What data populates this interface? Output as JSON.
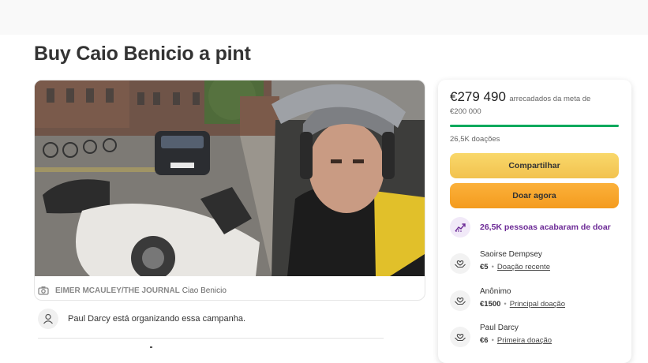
{
  "page": {
    "title": "Buy Caio Benicio a pint"
  },
  "photo": {
    "credit": "EIMER MCAULEY/THE JOURNAL",
    "caption": "Ciao Benicio"
  },
  "organizer": {
    "text": "Paul Darcy está organizando essa campanha."
  },
  "sidebar": {
    "raised_amount": "€279 490",
    "raised_label": "arrecadados da meta de",
    "goal": "€200 000",
    "progress_fraction": 1.0,
    "donations_count": "26,5K doações",
    "share_label": "Compartilhar",
    "donate_label": "Doar agora",
    "recent_banner": "26,5K pessoas acabaram de doar",
    "donors": [
      {
        "name": "Saoirse Dempsey",
        "amount": "€5",
        "tag": "Doação recente"
      },
      {
        "name": "Anônimo",
        "amount": "€1500",
        "tag": "Principal doação"
      },
      {
        "name": "Paul Darcy",
        "amount": "€6",
        "tag": "Primeira doação"
      }
    ]
  },
  "colors": {
    "progress": "#02a95c",
    "share_button": "#f2c24e",
    "donate_button": "#f49b1e",
    "recent_accent": "#6c2a96"
  },
  "icons": {
    "caption": "camera-icon",
    "organizer": "user-icon",
    "recent": "trend-up-icon",
    "donor": "heart-hands-icon"
  }
}
